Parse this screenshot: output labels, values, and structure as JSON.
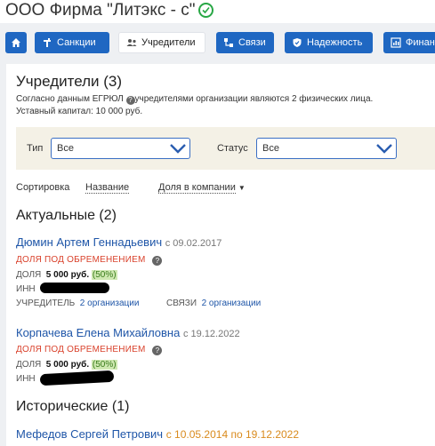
{
  "header": {
    "company_name": "ООО Фирма \"Литэкс - с\"",
    "verified_icon": "check-circle-icon"
  },
  "tabs": [
    {
      "label": "",
      "icon": "home-icon"
    },
    {
      "label": "Санкции",
      "icon": "sanctions-icon"
    },
    {
      "label": "Учредители",
      "icon": "founders-icon"
    },
    {
      "label": "Связи",
      "icon": "links-icon"
    },
    {
      "label": "Надежность",
      "icon": "shield-icon"
    },
    {
      "label": "Финан",
      "icon": "finance-icon"
    }
  ],
  "founders": {
    "title": "Учредители (3)",
    "note_before": "Согласно данным ЕГРЮЛ",
    "note_after": "учредителями организации являются 2 физических лица.",
    "capital": "Уставный капитал: 10 000 руб."
  },
  "filters": {
    "type_label": "Тип",
    "type_value": "Все",
    "status_label": "Статус",
    "status_value": "Все"
  },
  "sort": {
    "label": "Сортировка",
    "option_name": "Название",
    "option_share": "Доля в компании"
  },
  "current": {
    "title": "Актуальные (2)",
    "people": [
      {
        "name": "Дюмин Артем Геннадьевич",
        "since": "с 09.02.2017",
        "encumbrance": "ДОЛЯ ПОД ОБРЕМЕНЕНИЕМ",
        "share_label": "ДОЛЯ",
        "share_value": "5 000 руб.",
        "share_pct": "(50%)",
        "inn_label": "ИНН",
        "founder_label": "УЧРЕДИТЕЛЬ",
        "founder_link": "2 организации",
        "links_label": "СВЯЗИ",
        "links_link": "2 организации"
      },
      {
        "name": "Корпачева Елена Михайловна",
        "since": "с 19.12.2022",
        "encumbrance": "ДОЛЯ ПОД ОБРЕМЕНЕНИЕМ",
        "share_label": "ДОЛЯ",
        "share_value": "5 000 руб.",
        "share_pct": "(50%)",
        "inn_label": "ИНН"
      }
    ]
  },
  "historical": {
    "title": "Исторические (1)",
    "people": [
      {
        "name": "Мефедов Сергей Петрович",
        "period": "с 10.05.2014 по 19.12.2022"
      }
    ]
  }
}
